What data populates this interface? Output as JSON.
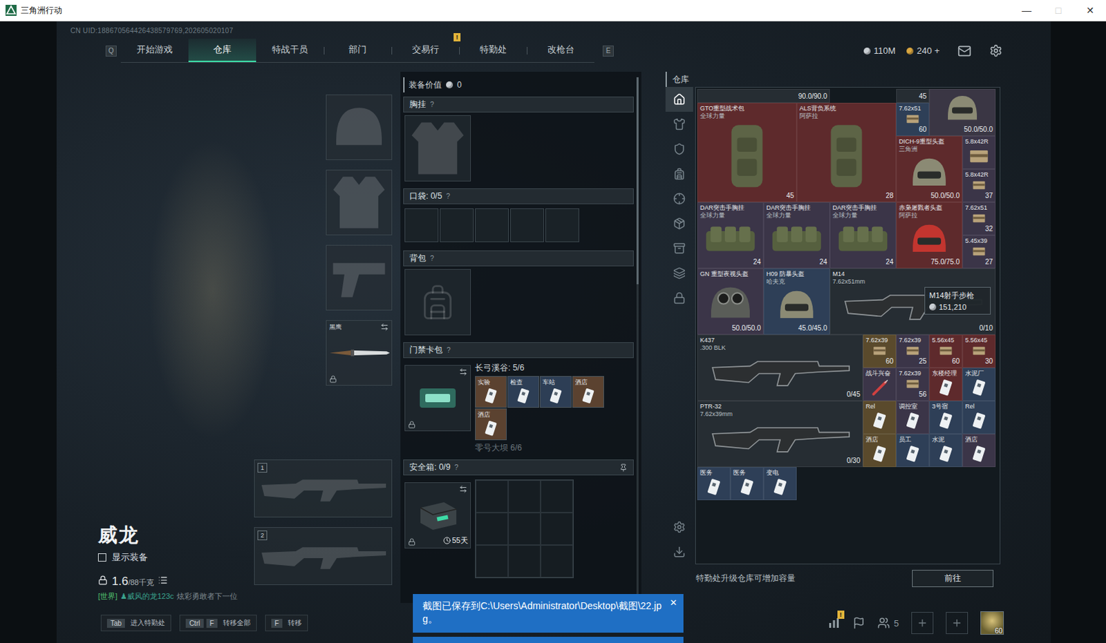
{
  "window": {
    "title": "三角洲行动",
    "controls": [
      {
        "glyph": "—",
        "disabled": false
      },
      {
        "glyph": "□",
        "disabled": true
      },
      {
        "glyph": "✕",
        "disabled": false
      }
    ]
  },
  "uid": "CN UID:188670564426438579769,202605020107",
  "nav": {
    "prev_key": "Q",
    "next_key": "E",
    "tabs": [
      {
        "label": "开始游戏",
        "selected": false
      },
      {
        "label": "仓库",
        "selected": true
      },
      {
        "label": "特战干员",
        "selected": false
      },
      {
        "label": "部门",
        "selected": false
      },
      {
        "label": "交易行",
        "selected": false
      },
      {
        "label": "特勤处",
        "selected": false,
        "badge": "!"
      },
      {
        "label": "改枪台",
        "selected": false
      }
    ]
  },
  "currency": [
    {
      "value": "110M",
      "color": "#c9ced3"
    },
    {
      "value": "240 +",
      "color": "#d8a640"
    }
  ],
  "character": {
    "name": "威龙",
    "show_equipment": {
      "label": "显示装备",
      "checked": false
    },
    "weight": "1.6",
    "capacity": "/88千克",
    "chat": {
      "channel": "[世界]",
      "sender": "♟威风的龙123c",
      "text": "炫彩勇敢者下一位"
    }
  },
  "equip_slots": [
    {
      "kind": "helmet"
    },
    {
      "kind": "armor"
    },
    {
      "kind": "pistol"
    },
    {
      "kind": "melee",
      "label": "黑鹰",
      "locked": true
    }
  ],
  "weapon_slots": [
    {
      "number": "1"
    },
    {
      "number": "2"
    }
  ],
  "loadout": {
    "value_label": "装备价值",
    "value": "0",
    "chest_rig": {
      "title": "胸挂",
      "help": "?"
    },
    "pockets": {
      "title": "口袋: 0/5",
      "help": "?",
      "slots": 5
    },
    "backpack": {
      "title": "背包",
      "help": "?"
    },
    "keycards": {
      "title": "门禁卡包",
      "help": "?",
      "locked": true,
      "groups": [
        {
          "title": "长弓溪谷: 5/6",
          "faded": false,
          "cards": [
            {
              "name": "实验",
              "color": "#5b4230"
            },
            {
              "name": "检查",
              "color": "#2d3e55"
            },
            {
              "name": "车站",
              "color": "#2d3e55"
            },
            {
              "name": "酒店",
              "color": "#5b4230"
            },
            {
              "name": "酒店",
              "color": "#5b4230"
            }
          ]
        },
        {
          "title": "零号大坝 6/6",
          "faded": true,
          "cards": []
        }
      ]
    },
    "safebox": {
      "title": "安全箱: 0/9",
      "help": "?",
      "days": "55天",
      "locked": true,
      "slots": 9
    }
  },
  "warehouse": {
    "title": "仓库",
    "sidebar": [
      {
        "selected": true
      },
      {
        "selected": false
      },
      {
        "selected": false
      },
      {
        "selected": false
      },
      {
        "selected": false
      },
      {
        "selected": false
      },
      {
        "selected": false
      },
      {
        "selected": false
      },
      {
        "selected": false
      },
      {
        "selected": false
      },
      {
        "selected": false
      }
    ],
    "items": [
      {
        "kind": "partial",
        "count": "90.0/90.0",
        "color": "#262d33"
      },
      {
        "kind": "partial",
        "count": "45",
        "color": "#262d33"
      },
      {
        "kind": "helmet",
        "count": "50.0/50.0",
        "color": "#3a3644"
      },
      {
        "kind": "backpack",
        "name": "GTO重型战术包",
        "sub": "全球力量",
        "count": "45",
        "color": "#5e2a2c"
      },
      {
        "kind": "backpack",
        "name": "ALS背负系统",
        "sub": "阿萨拉",
        "count": "28",
        "color": "#5e2a2c"
      },
      {
        "kind": "ammo",
        "name": "7.62x51",
        "count": "60",
        "color": "#2e3f57"
      },
      {
        "kind": "helmet",
        "name": "DICH-9重型头盔",
        "sub": "三角洲",
        "count": "50.0/50.0",
        "color": "#5e2a2c"
      },
      {
        "kind": "ammo",
        "name": "5.8x42R",
        "color": "#3b3548"
      },
      {
        "kind": "ammo",
        "name": "5.8x42R",
        "count": "37",
        "color": "#3b3548"
      },
      {
        "kind": "rig",
        "name": "DAR突击手胸挂",
        "sub": "全球力量",
        "count": "24",
        "color": "#3b3548"
      },
      {
        "kind": "rig",
        "name": "DAR突击手胸挂",
        "sub": "全球力量",
        "count": "24",
        "color": "#3b3548"
      },
      {
        "kind": "rig",
        "name": "DAR突击手胸挂",
        "sub": "全球力量",
        "count": "24",
        "color": "#3b3548"
      },
      {
        "kind": "mask",
        "name": "赤枭屠戮者头盔",
        "sub": "阿萨拉",
        "count": "75.0/75.0",
        "color": "#5e2a2c"
      },
      {
        "kind": "ammo",
        "name": "7.62x51",
        "count": "32",
        "color": "#3b3548"
      },
      {
        "kind": "ammo",
        "name": "5.45x39",
        "count": "27",
        "color": "#3b3548"
      },
      {
        "kind": "nvg",
        "name": "GN 重型夜视头盔",
        "count": "50.0/50.0",
        "color": "#3b3548"
      },
      {
        "kind": "helmet",
        "name": "H09 防暴头盔",
        "sub": "哈夫克",
        "count": "45.0/45.0",
        "color": "#2e3f57"
      },
      {
        "kind": "gun",
        "name": "M14",
        "sub": "7.62x51mm",
        "count": "0/10",
        "color": "#262d33",
        "tooltip": {
          "name": "M14射手步枪",
          "price": "151,210"
        }
      },
      {
        "kind": "gun",
        "name": "K437",
        "sub": ".300 BLK",
        "count": "0/45",
        "color": "#262d33"
      },
      {
        "kind": "ammo",
        "name": "7.62x39",
        "count": "60",
        "color": "#5a4a2c"
      },
      {
        "kind": "ammo",
        "name": "7.62x39",
        "count": "25",
        "color": "#3b3548"
      },
      {
        "kind": "ammo",
        "name": "5.56x45",
        "count": "60",
        "color": "#5e2a2c"
      },
      {
        "kind": "ammo",
        "name": "5.56x45",
        "count": "30",
        "color": "#5e2a2c"
      },
      {
        "kind": "syringe",
        "name": "战斗兴奋",
        "color": "#3b3548"
      },
      {
        "kind": "ammo",
        "name": "7.62x39",
        "count": "56",
        "color": "#3b3548"
      },
      {
        "kind": "card",
        "name": "东楼经理",
        "color": "#5e2a2c"
      },
      {
        "kind": "card",
        "name": "水泥厂",
        "color": "#2e3f57"
      },
      {
        "kind": "gun",
        "name": "PTR-32",
        "sub": "7.62x39mm",
        "count": "0/30",
        "color": "#262d33"
      },
      {
        "kind": "card",
        "name": "Rel",
        "color": "#5a4a2c"
      },
      {
        "kind": "card",
        "name": "调控室",
        "color": "#3b3548"
      },
      {
        "kind": "card",
        "name": "3号宿",
        "color": "#2e3f57"
      },
      {
        "kind": "card",
        "name": "Rel",
        "color": "#2e3f57"
      },
      {
        "kind": "card",
        "name": "酒店",
        "color": "#5a4a2c"
      },
      {
        "kind": "card",
        "name": "员工",
        "color": "#2e3f57"
      },
      {
        "kind": "card",
        "name": "水泥",
        "color": "#2e3f57"
      },
      {
        "kind": "card",
        "name": "酒店",
        "color": "#3b3548"
      },
      {
        "kind": "card",
        "name": "医务",
        "color": "#2e3f57"
      },
      {
        "kind": "card",
        "name": "医务",
        "color": "#2e3f57"
      },
      {
        "kind": "card",
        "name": "变电",
        "color": "#2e3f57"
      }
    ],
    "footer": "特勤处升级仓库可增加容量",
    "button": "前往"
  },
  "hints": [
    {
      "keys": [
        "Tab"
      ],
      "label": "进入特勤处"
    },
    {
      "keys": [
        "Ctrl",
        "F"
      ],
      "label": "转移全部"
    },
    {
      "keys": [
        "F"
      ],
      "label": "转移"
    }
  ],
  "tray": {
    "stats_badge": "!",
    "friends": "5",
    "level": "60"
  },
  "toast": {
    "message": "截图已保存到C:\\Users\\Administrator\\Desktop\\截图\\22.jpg。",
    "close": "✕"
  }
}
